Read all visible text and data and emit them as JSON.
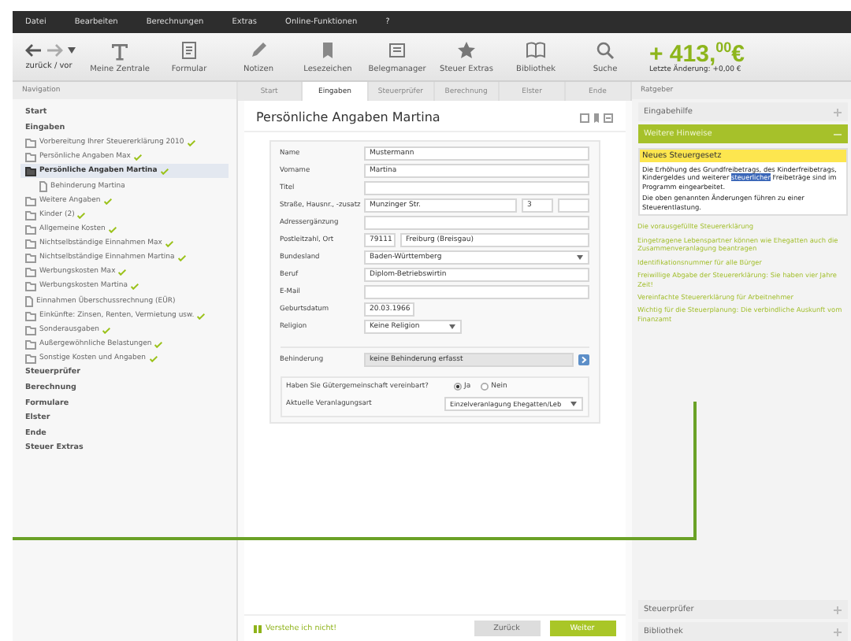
{
  "menu": [
    "Datei",
    "Bearbeiten",
    "Berechnungen",
    "Extras",
    "Online-Funktionen",
    "?"
  ],
  "toolbar": {
    "nav_label": "zurück / vor",
    "buttons": [
      {
        "kind": "text",
        "label": "Meine Zentrale"
      },
      {
        "kind": "form",
        "label": "Formular"
      },
      {
        "kind": "pencil",
        "label": "Notizen"
      },
      {
        "kind": "bookmark",
        "label": "Lesezeichen"
      },
      {
        "kind": "doc",
        "label": "Belegmanager"
      },
      {
        "kind": "star",
        "label": "Steuer Extras"
      },
      {
        "kind": "book",
        "label": "Bibliothek"
      },
      {
        "kind": "search",
        "label": "Suche"
      }
    ],
    "amount": "+ 413,$^{00}$€",
    "last_change": "Letzte Änderung: +0,00 €"
  },
  "navigation": {
    "title": "Navigation",
    "items": [
      {
        "kind": "header",
        "label": "Start",
        "selected": false
      },
      {
        "kind": "header",
        "label": "Eingaben",
        "selected": false
      },
      {
        "kind": "folder",
        "label": "Vorbereitung Ihrer Steuererklärung 2010",
        "checked": true,
        "selected": false
      },
      {
        "kind": "folder",
        "label": "Persönliche Angaben Max",
        "checked": true,
        "selected": false
      },
      {
        "kind": "folder",
        "label": "Persönliche Angaben Martina",
        "checked": true,
        "selected": true,
        "children": [
          {
            "kind": "page",
            "label": "Behinderung Martina",
            "checked": false,
            "selected": false
          }
        ]
      },
      {
        "kind": "folder",
        "label": "Weitere Angaben",
        "checked": true,
        "selected": false
      },
      {
        "kind": "folder",
        "label": "Kinder (2)",
        "checked": true,
        "selected": false
      },
      {
        "kind": "folder",
        "label": "Allgemeine Kosten",
        "checked": true,
        "selected": false
      },
      {
        "kind": "folder",
        "label": "Nichtselbständige Einnahmen Max",
        "checked": true,
        "selected": false
      },
      {
        "kind": "folder",
        "label": "Nichtselbständige Einnahmen Martina",
        "checked": true,
        "selected": false
      },
      {
        "kind": "folder",
        "label": "Werbungskosten Max",
        "checked": true,
        "selected": false
      },
      {
        "kind": "folder",
        "label": "Werbungskosten Martina",
        "checked": true,
        "selected": false
      },
      {
        "kind": "page",
        "label": "Einnahmen Überschussrechnung (EÜR)",
        "checked": false,
        "selected": false
      },
      {
        "kind": "folder",
        "label": "Einkünfte: Zinsen, Renten, Vermietung usw.",
        "checked": true,
        "selected": false
      },
      {
        "kind": "folder",
        "label": "Sonderausgaben",
        "checked": true,
        "selected": false
      },
      {
        "kind": "folder",
        "label": "Außergewöhnliche Belastungen",
        "checked": true,
        "selected": false
      },
      {
        "kind": "folder",
        "label": "Sonstige Kosten und Angaben",
        "checked": true,
        "selected": false
      },
      {
        "kind": "header",
        "label": "Steuerprüfer",
        "selected": false
      },
      {
        "kind": "header",
        "label": "Berechnung",
        "selected": false
      },
      {
        "kind": "header",
        "label": "Formulare",
        "selected": false
      },
      {
        "kind": "header",
        "label": "Elster",
        "selected": false
      },
      {
        "kind": "header",
        "label": "Ende",
        "selected": false
      },
      {
        "kind": "header",
        "label": "Steuer Extras",
        "selected": false
      }
    ]
  },
  "tabs": [
    {
      "label": "Start",
      "selected": false
    },
    {
      "label": "Eingaben",
      "selected": true
    },
    {
      "label": "Steuerprüfer",
      "selected": false
    },
    {
      "label": "Berechnung",
      "selected": false
    },
    {
      "label": "Elster",
      "selected": false
    },
    {
      "label": "Ende",
      "selected": false
    }
  ],
  "page": {
    "title": "Persönliche Angaben Martina",
    "rows": [
      {
        "label": "Name",
        "fields": [
          {
            "kind": "text",
            "value": "Mustermann"
          }
        ]
      },
      {
        "label": "Vorname",
        "fields": [
          {
            "kind": "text",
            "value": "Martina"
          }
        ]
      },
      {
        "label": "Titel",
        "fields": [
          {
            "kind": "text"
          }
        ]
      },
      {
        "label": "Straße, Hausnr., -zusatz",
        "fields": [
          {
            "kind": "text",
            "value": "Munzinger Str."
          },
          {
            "kind": "short",
            "value": "3"
          },
          {
            "kind": "short"
          }
        ]
      },
      {
        "label": "Adressergänzung",
        "fields": [
          {
            "kind": "text"
          }
        ]
      },
      {
        "label": "Postleitzahl, Ort",
        "fields": [
          {
            "kind": "short",
            "value": "79111"
          },
          {
            "kind": "text",
            "value": "Freiburg (Breisgau)"
          }
        ]
      },
      {
        "label": "Bundesland",
        "fields": [
          {
            "kind": "select",
            "value": "Baden-Württemberg"
          }
        ]
      },
      {
        "label": "Beruf",
        "fields": [
          {
            "kind": "text",
            "value": "Diplom-Betriebswirtin"
          }
        ]
      },
      {
        "label": "E-Mail",
        "fields": [
          {
            "kind": "text"
          }
        ]
      },
      {
        "label": "Geburtsdatum",
        "fields": [
          {
            "kind": "date",
            "value": "20.03.1966"
          }
        ]
      },
      {
        "label": "Religion",
        "fields": [
          {
            "kind": "smallselect",
            "value": "Keine Religion"
          }
        ]
      }
    ],
    "disability": {
      "label": "Behinderung",
      "value": "keine Behinderung erfasst"
    },
    "question": {
      "label": "Haben Sie Gütergemeinschaft vereinbart?",
      "options": [
        {
          "label": "Ja",
          "selected": true
        },
        {
          "label": "Nein",
          "selected": false
        }
      ]
    },
    "assessment": {
      "label": "Aktuelle Veranlagungsart",
      "value": "Einzelveranlagung Ehegatten/Leb"
    },
    "help_link": "Verstehe ich nicht!",
    "buttons": [
      {
        "kind": "back",
        "label": "Zurück"
      },
      {
        "kind": "next",
        "label": "Weiter"
      }
    ]
  },
  "advisor": {
    "title": "Ratgeber",
    "sections_top": [
      {
        "label": "Eingabehilfe",
        "expanded": false
      },
      {
        "label": "Weitere Hinweise",
        "expanded": true
      }
    ],
    "note": {
      "title": "Neues Steuergesetz",
      "paragraphs": [
        [
          {
            "text": "Die Erhöhung des Grundfreibetrags, des Kinderfreibetrags, Kindergeldes und weiterer ",
            "selected": false
          },
          {
            "text": "steuerlicher",
            "selected": true
          },
          {
            "text": " Freibeträge sind im Programm eingearbeitet.",
            "selected": false
          }
        ],
        [
          {
            "text": "Die oben genannten Änderungen führen zu einer Steuerentlastung.",
            "selected": false
          }
        ]
      ]
    },
    "links": [
      "Die vorausgefüllte Steuererklärung",
      "Eingetragene Lebenspartner können wie Ehegatten auch die Zusammenveranlagung beantragen",
      "Identifikationsnummer für alle Bürger",
      "Freiwillige Abgabe der Steuererklärung: Sie haben vier Jahre Zeit!",
      "Vereinfachte Steuererklärung für Arbeitnehmer",
      "Wichtig für die Steuerplanung: Die verbindliche Auskunft vom Finanzamt"
    ],
    "sections_bottom": [
      {
        "label": "Steuerprüfer",
        "expanded": false
      },
      {
        "label": "Bibliothek",
        "expanded": false
      }
    ]
  }
}
